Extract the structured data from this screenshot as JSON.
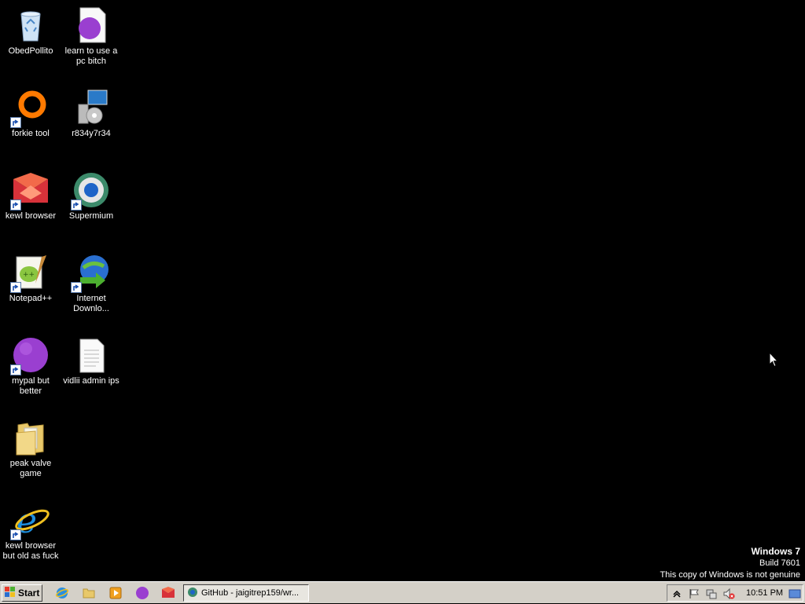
{
  "desktop": {
    "icons": [
      {
        "label": "ObedPollito",
        "icon": "recycle-bin-icon"
      },
      {
        "label": "learn to use a pc bitch",
        "icon": "purple-document-icon"
      },
      {
        "label": "forkie tool",
        "icon": "orange-ring-icon"
      },
      {
        "label": "r834y7r34",
        "icon": "setup-computer-icon"
      },
      {
        "label": "kewl browser",
        "icon": "red-browser-icon"
      },
      {
        "label": "Supermium",
        "icon": "supermium-icon"
      },
      {
        "label": "Notepad++",
        "icon": "notepadpp-icon"
      },
      {
        "label": "Internet Downlo...",
        "icon": "idm-globe-icon"
      },
      {
        "label": "mypal but better",
        "icon": "purple-globe-icon"
      },
      {
        "label": "vidlii admin ips",
        "icon": "text-file-icon"
      },
      {
        "label": "peak valve game",
        "icon": "folder-icon"
      },
      {
        "label": "kewl browser but old as fuck",
        "icon": "internet-explorer-icon"
      }
    ]
  },
  "watermark": {
    "line1": "Windows 7",
    "line2": "Build 7601",
    "line3": "This copy of Windows is not genuine"
  },
  "taskbar": {
    "start_label": "Start",
    "quick_launch": [
      "internet-explorer-icon",
      "explorer-folder-icon",
      "media-player-icon",
      "purple-globe-icon",
      "red-browser-icon"
    ],
    "active_task": "GitHub - jaigitrep159/wr...",
    "clock": "10:51 PM"
  },
  "colors": {
    "desktop_background": "#000000",
    "taskbar": "#d4d0c8"
  }
}
